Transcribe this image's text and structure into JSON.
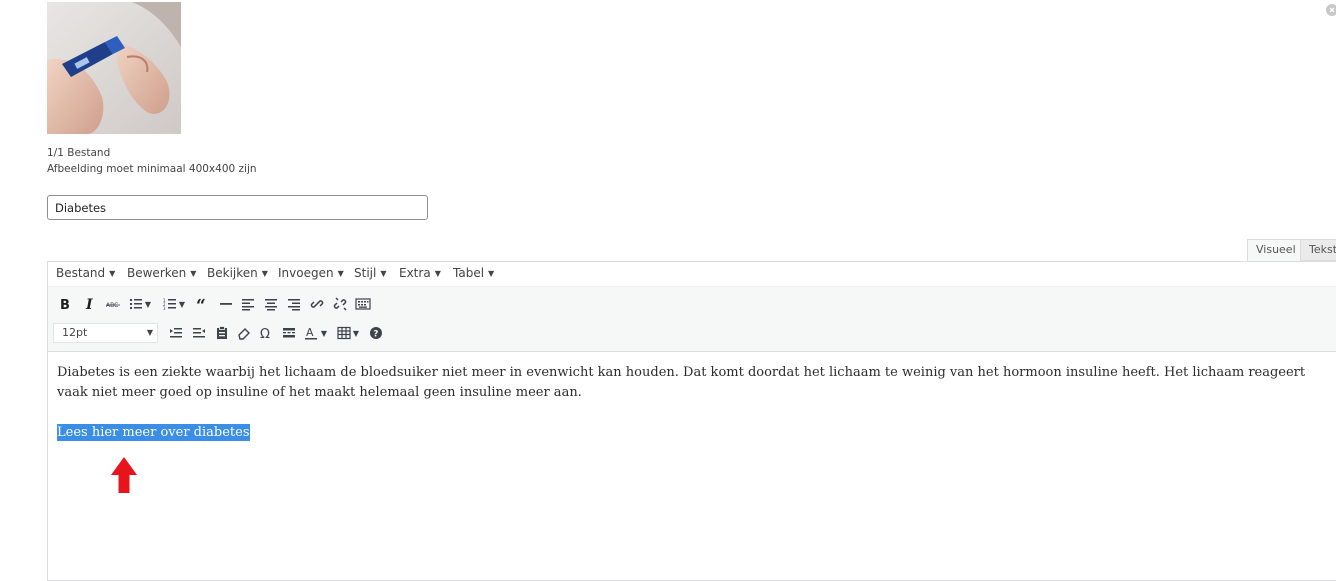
{
  "upload": {
    "file_count": "1/1 Bestand",
    "hint": "Afbeelding moet minimaal 400x400 zijn"
  },
  "title_field": {
    "value": "Diabetes"
  },
  "editor_tabs": {
    "visual": "Visueel",
    "text": "Tekst"
  },
  "menubar": [
    {
      "label": "Bestand"
    },
    {
      "label": "Bewerken"
    },
    {
      "label": "Bekijken"
    },
    {
      "label": "Invoegen"
    },
    {
      "label": "Stijl"
    },
    {
      "label": "Extra"
    },
    {
      "label": "Tabel"
    }
  ],
  "toolbar": {
    "font_size": "12pt",
    "row1_icons": [
      "bold-icon",
      "italic-icon",
      "strikethrough-icon",
      "bullet-list-icon",
      "numbered-list-icon",
      "blockquote-icon",
      "horizontal-line-icon",
      "align-left-icon",
      "align-center-icon",
      "align-right-icon",
      "link-icon",
      "unlink-icon",
      "keyboard-icon"
    ],
    "row2_icons": [
      "indent-icon",
      "outdent-icon",
      "paste-icon",
      "eraser-icon",
      "omega-icon",
      "read-more-icon",
      "text-color-icon",
      "table-icon",
      "help-icon"
    ]
  },
  "content": {
    "paragraph": "Diabetes is een ziekte waarbij het lichaam de bloedsuiker niet meer in evenwicht kan houden. Dat komt doordat het lichaam te weinig van het hormoon insuline heeft. Het lichaam reageert vaak niet meer goed op insuline of het maakt helemaal geen insuline meer aan.",
    "selected_link_text": "Lees hier meer over diabetes"
  },
  "colors": {
    "selection": "#3b8ee6",
    "arrow": "#e8141b"
  }
}
